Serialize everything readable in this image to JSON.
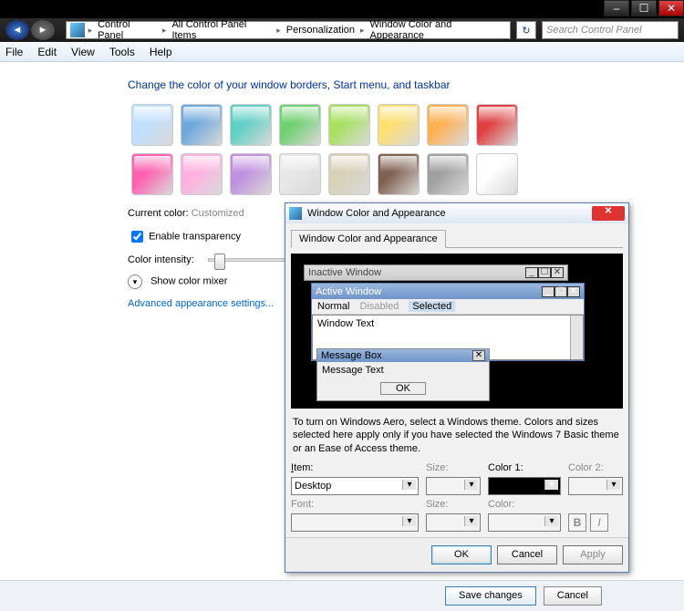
{
  "window_controls": {
    "min": "–",
    "max": "☐",
    "close": "✕"
  },
  "breadcrumb": [
    "Control Panel",
    "All Control Panel Items",
    "Personalization",
    "Window Color and Appearance"
  ],
  "search_placeholder": "Search Control Panel",
  "menubar": [
    "File",
    "Edit",
    "View",
    "Tools",
    "Help"
  ],
  "heading": "Change the color of your window borders, Start menu, and taskbar",
  "swatch_colors": [
    "#bfe0ff",
    "#6fa8dc",
    "#5fd0c5",
    "#6fd070",
    "#a8e060",
    "#ffe070",
    "#ffb050",
    "#e04040",
    "#ff60b0",
    "#ffb0e0",
    "#c090e0",
    "#e8e8e8",
    "#d8d0b8",
    "#806050",
    "#a0a0a0",
    "#ffffff"
  ],
  "current_color_label": "Current color:",
  "current_color_value": "Customized",
  "enable_transparency": "Enable transparency",
  "color_intensity": "Color intensity:",
  "show_mixer": "Show color mixer",
  "adv_link": "Advanced appearance settings...",
  "page_buttons": {
    "save": "Save changes",
    "cancel": "Cancel"
  },
  "dialog": {
    "title": "Window Color and Appearance",
    "tab": "Window Color and Appearance",
    "preview": {
      "inactive": "Inactive Window",
      "active": "Active Window",
      "menu_normal": "Normal",
      "menu_disabled": "Disabled",
      "menu_selected": "Selected",
      "window_text": "Window Text",
      "msg_title": "Message Box",
      "msg_text": "Message Text",
      "msg_ok": "OK"
    },
    "note": "To turn on Windows Aero, select a Windows theme.  Colors and sizes selected here apply only if you have selected the Windows 7 Basic theme or an Ease of Access theme.",
    "labels": {
      "item": "Item:",
      "size": "Size:",
      "color1": "Color 1:",
      "color2": "Color 2:",
      "font": "Font:",
      "color": "Color:"
    },
    "item_value": "Desktop",
    "buttons": {
      "ok": "OK",
      "cancel": "Cancel",
      "apply": "Apply"
    }
  }
}
